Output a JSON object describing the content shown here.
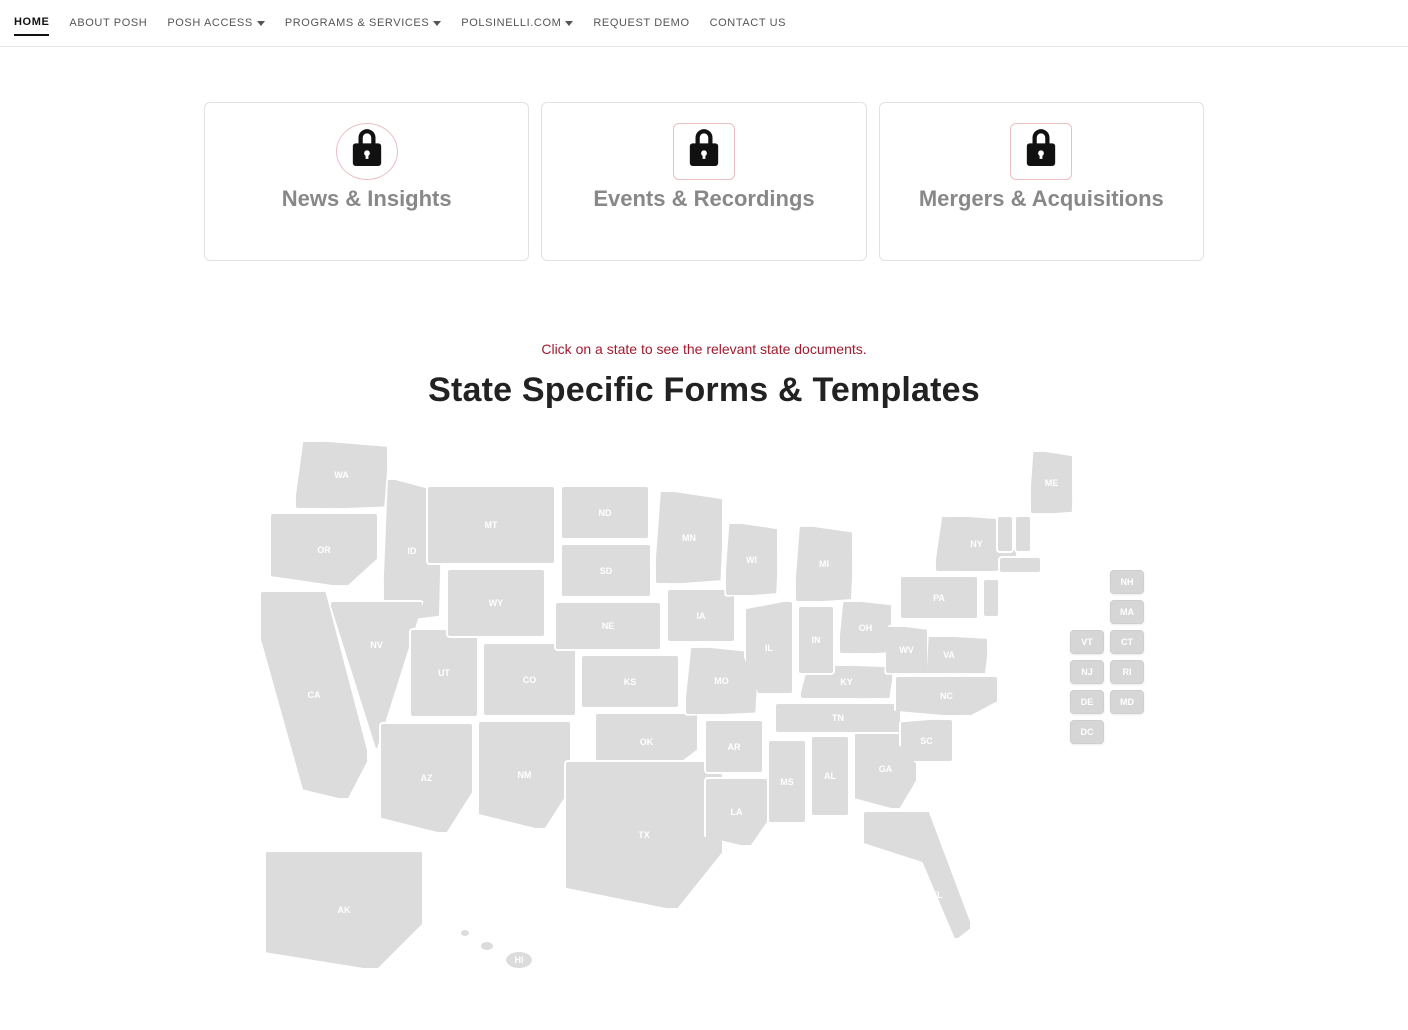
{
  "nav": {
    "items": [
      {
        "label": "HOME",
        "active": true,
        "dropdown": false
      },
      {
        "label": "ABOUT POSH",
        "active": false,
        "dropdown": false
      },
      {
        "label": "POSH ACCESS",
        "active": false,
        "dropdown": true
      },
      {
        "label": "PROGRAMS & SERVICES",
        "active": false,
        "dropdown": true
      },
      {
        "label": "POLSINELLI.COM",
        "active": false,
        "dropdown": true
      },
      {
        "label": "REQUEST DEMO",
        "active": false,
        "dropdown": false
      },
      {
        "label": "CONTACT US",
        "active": false,
        "dropdown": false
      }
    ]
  },
  "cards": [
    {
      "title": "News & Insights"
    },
    {
      "title": "Events & Recordings"
    },
    {
      "title": "Mergers & Acquisitions"
    }
  ],
  "section": {
    "hint": "Click on a state to see the relevant state documents.",
    "title": "State Specific Forms & Templates"
  },
  "states_on_map": [
    "WA",
    "OR",
    "CA",
    "ID",
    "NV",
    "UT",
    "AZ",
    "MT",
    "WY",
    "CO",
    "NM",
    "ND",
    "SD",
    "NE",
    "KS",
    "OK",
    "TX",
    "MN",
    "IA",
    "MO",
    "AR",
    "LA",
    "WI",
    "IL",
    "MS",
    "AL",
    "GA",
    "FL",
    "TN",
    "KY",
    "IN",
    "OH",
    "MI",
    "SC",
    "NC",
    "VA",
    "WV",
    "PA",
    "NY",
    "ME",
    "AK",
    "HI"
  ],
  "legend_right": [
    "NH",
    "MA",
    "CT",
    "RI",
    "MD"
  ],
  "legend_left": [
    "VT",
    "NJ",
    "DE",
    "DC"
  ]
}
